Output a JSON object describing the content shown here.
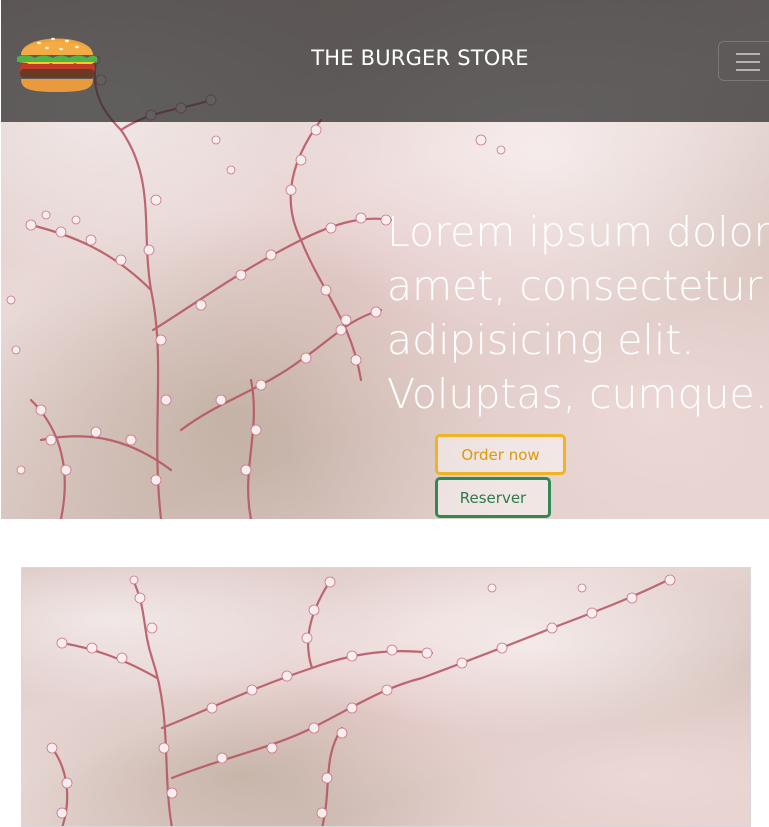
{
  "navbar": {
    "brand": "THE BURGER STORE",
    "logo_icon": "burger-icon",
    "menu_icon": "hamburger-menu-icon"
  },
  "hero": {
    "headline": "Lorem ipsum dolor sit amet, consectetur adipisicing elit. Voluptas, cumque.",
    "order_button": "Order now",
    "reserve_button": "Reserver"
  },
  "colors": {
    "order_accent": "#f0b323",
    "reserve_accent": "#2e8a52",
    "navbar_bg": "#282828"
  }
}
